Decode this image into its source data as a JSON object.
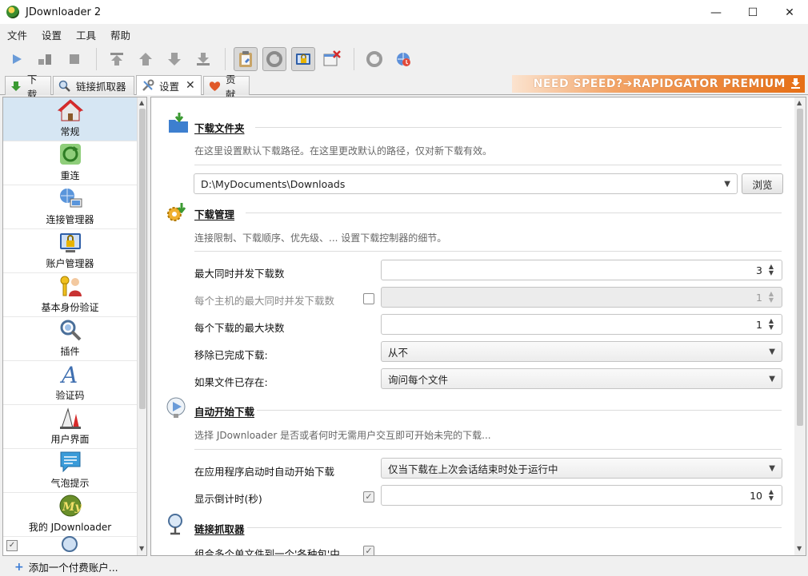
{
  "window": {
    "title": "JDownloader 2",
    "minimize": "—",
    "maximize": "☐",
    "close": "✕"
  },
  "menu": [
    "文件",
    "设置",
    "工具",
    "帮助"
  ],
  "tabs": [
    {
      "label": "下载",
      "icon": "download-arrow-icon"
    },
    {
      "label": "链接抓取器",
      "icon": "linkgrabber-icon"
    },
    {
      "label": "设置",
      "icon": "settings-tools-icon",
      "active": true,
      "closable": true
    },
    {
      "label": "贡献",
      "icon": "heart-icon"
    }
  ],
  "promo": "NEED SPEED?➔RAPIDGATOR PREMIUM",
  "sidebar": {
    "items": [
      {
        "label": "常规",
        "icon": "home-icon",
        "active": true
      },
      {
        "label": "重连",
        "icon": "reconnect-icon"
      },
      {
        "label": "连接管理器",
        "icon": "connection-manager-icon"
      },
      {
        "label": "账户管理器",
        "icon": "account-manager-icon"
      },
      {
        "label": "基本身份验证",
        "icon": "basic-auth-icon"
      },
      {
        "label": "插件",
        "icon": "plugins-icon"
      },
      {
        "label": "验证码",
        "icon": "captcha-icon"
      },
      {
        "label": "用户界面",
        "icon": "user-interface-icon"
      },
      {
        "label": "气泡提示",
        "icon": "bubble-notify-icon"
      },
      {
        "label": "我的 JDownloader",
        "icon": "my-jdownloader-icon"
      }
    ]
  },
  "sections": {
    "download_folder": {
      "title": "下载文件夹",
      "desc": "在这里设置默认下载路径。在这里更改默认的路径，仅对新下载有效。",
      "path": "D:\\MyDocuments\\Downloads",
      "browse": "浏览"
    },
    "download_management": {
      "title": "下载管理",
      "desc": "连接限制、下载顺序、优先级、... 设置下载控制器的细节。",
      "rows": [
        {
          "label": "最大同时并发下载数",
          "value": "3"
        },
        {
          "label": "每个主机的最大同时并发下载数",
          "value": "1"
        },
        {
          "label": "每个下载的最大块数",
          "value": "1"
        },
        {
          "label": "移除已完成下载:",
          "value": "从不"
        },
        {
          "label": "如果文件已存在:",
          "value": "询问每个文件"
        }
      ]
    },
    "auto_start": {
      "title": "自动开始下载",
      "desc": "选择 JDownloader 是否或者何时无需用户交互即可开始未完的下载...",
      "rows": [
        {
          "label": "在应用程序启动时自动开始下载",
          "value": "仅当下载在上次会话结束时处于运行中"
        },
        {
          "label": "显示倒计时(秒)",
          "value": "10"
        }
      ]
    },
    "linkgrabber": {
      "title": "链接抓取器",
      "rows": [
        {
          "label": "组合多个单文件到一个'各种包'中"
        }
      ]
    }
  },
  "statusbar": {
    "add_account": "添加一个付费账户..."
  }
}
